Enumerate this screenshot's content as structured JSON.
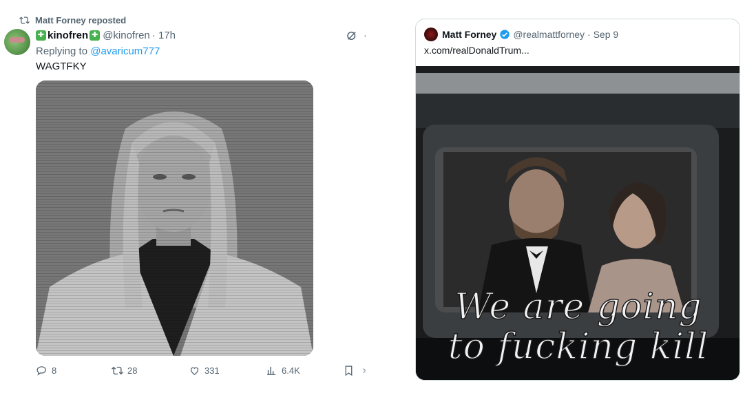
{
  "repost": {
    "label": "Matt Forney reposted",
    "icon": "repost-icon"
  },
  "tweet": {
    "display_name": "kinofren",
    "handle": "@kinofren",
    "time": "· 17h",
    "replying_prefix": "Replying to ",
    "replying_to": "@avaricum777",
    "text": "WAGTFKY",
    "actions": {
      "replies": "8",
      "reposts": "28",
      "likes": "331",
      "views": "6.4K"
    }
  },
  "quoted": {
    "display_name": "Matt Forney",
    "handle": "@realmattforney",
    "date": "· Sep 9",
    "text": "x.com/realDonaldTrum...",
    "caption_line1": "We are going",
    "caption_line2": "to fucking kill you"
  },
  "colors": {
    "accent": "#1d9bf0",
    "muted": "#536471",
    "clover": "#48b04f"
  }
}
